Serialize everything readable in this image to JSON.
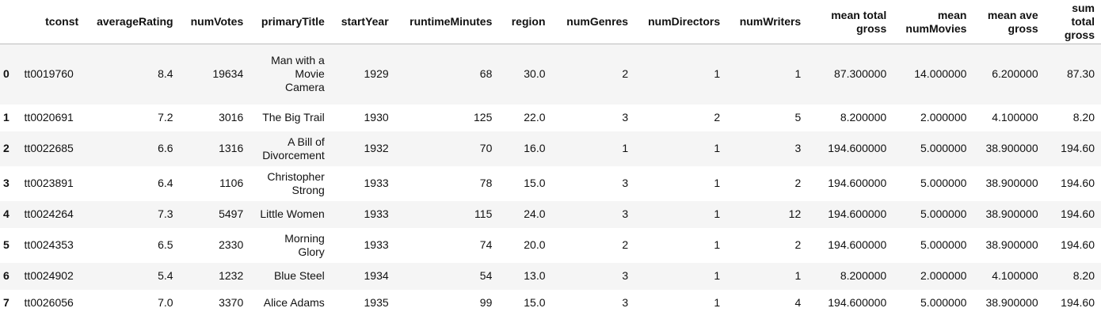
{
  "table": {
    "columns": [
      "",
      "tconst",
      "averageRating",
      "numVotes",
      "primaryTitle",
      "startYear",
      "runtimeMinutes",
      "region",
      "numGenres",
      "numDirectors",
      "numWriters",
      "mean total gross",
      "mean numMovies",
      "mean ave gross",
      "sum total gross"
    ],
    "rows": [
      {
        "idx": "0",
        "tconst": "tt0019760",
        "averageRating": "8.4",
        "numVotes": "19634",
        "primaryTitle": "Man with a Movie Camera",
        "startYear": "1929",
        "runtimeMinutes": "68",
        "region": "30.0",
        "numGenres": "2",
        "numDirectors": "1",
        "numWriters": "1",
        "mean_total_gross": "87.300000",
        "mean_numMovies": "14.000000",
        "mean_ave_gross": "6.200000",
        "sum_total_gross": "87.30"
      },
      {
        "idx": "1",
        "tconst": "tt0020691",
        "averageRating": "7.2",
        "numVotes": "3016",
        "primaryTitle": "The Big Trail",
        "startYear": "1930",
        "runtimeMinutes": "125",
        "region": "22.0",
        "numGenres": "3",
        "numDirectors": "2",
        "numWriters": "5",
        "mean_total_gross": "8.200000",
        "mean_numMovies": "2.000000",
        "mean_ave_gross": "4.100000",
        "sum_total_gross": "8.20"
      },
      {
        "idx": "2",
        "tconst": "tt0022685",
        "averageRating": "6.6",
        "numVotes": "1316",
        "primaryTitle": "A Bill of Divorcement",
        "startYear": "1932",
        "runtimeMinutes": "70",
        "region": "16.0",
        "numGenres": "1",
        "numDirectors": "1",
        "numWriters": "3",
        "mean_total_gross": "194.600000",
        "mean_numMovies": "5.000000",
        "mean_ave_gross": "38.900000",
        "sum_total_gross": "194.60"
      },
      {
        "idx": "3",
        "tconst": "tt0023891",
        "averageRating": "6.4",
        "numVotes": "1106",
        "primaryTitle": "Christopher Strong",
        "startYear": "1933",
        "runtimeMinutes": "78",
        "region": "15.0",
        "numGenres": "3",
        "numDirectors": "1",
        "numWriters": "2",
        "mean_total_gross": "194.600000",
        "mean_numMovies": "5.000000",
        "mean_ave_gross": "38.900000",
        "sum_total_gross": "194.60"
      },
      {
        "idx": "4",
        "tconst": "tt0024264",
        "averageRating": "7.3",
        "numVotes": "5497",
        "primaryTitle": "Little Women",
        "startYear": "1933",
        "runtimeMinutes": "115",
        "region": "24.0",
        "numGenres": "3",
        "numDirectors": "1",
        "numWriters": "12",
        "mean_total_gross": "194.600000",
        "mean_numMovies": "5.000000",
        "mean_ave_gross": "38.900000",
        "sum_total_gross": "194.60"
      },
      {
        "idx": "5",
        "tconst": "tt0024353",
        "averageRating": "6.5",
        "numVotes": "2330",
        "primaryTitle": "Morning Glory",
        "startYear": "1933",
        "runtimeMinutes": "74",
        "region": "20.0",
        "numGenres": "2",
        "numDirectors": "1",
        "numWriters": "2",
        "mean_total_gross": "194.600000",
        "mean_numMovies": "5.000000",
        "mean_ave_gross": "38.900000",
        "sum_total_gross": "194.60"
      },
      {
        "idx": "6",
        "tconst": "tt0024902",
        "averageRating": "5.4",
        "numVotes": "1232",
        "primaryTitle": "Blue Steel",
        "startYear": "1934",
        "runtimeMinutes": "54",
        "region": "13.0",
        "numGenres": "3",
        "numDirectors": "1",
        "numWriters": "1",
        "mean_total_gross": "8.200000",
        "mean_numMovies": "2.000000",
        "mean_ave_gross": "4.100000",
        "sum_total_gross": "8.20"
      },
      {
        "idx": "7",
        "tconst": "tt0026056",
        "averageRating": "7.0",
        "numVotes": "3370",
        "primaryTitle": "Alice Adams",
        "startYear": "1935",
        "runtimeMinutes": "99",
        "region": "15.0",
        "numGenres": "3",
        "numDirectors": "1",
        "numWriters": "4",
        "mean_total_gross": "194.600000",
        "mean_numMovies": "5.000000",
        "mean_ave_gross": "38.900000",
        "sum_total_gross": "194.60"
      }
    ]
  }
}
